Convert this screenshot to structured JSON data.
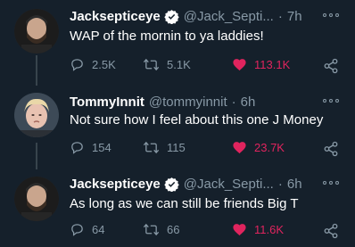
{
  "tweets": [
    {
      "name": "Jacksepticeye",
      "verified": true,
      "handle": "@Jack_Septi...",
      "separator": "·",
      "time": "7h",
      "text": "WAP of the mornin to ya laddies!",
      "replies": "2.5K",
      "retweets": "5.1K",
      "likes": "113.1K",
      "liked": true
    },
    {
      "name": "TommyInnit",
      "verified": false,
      "handle": "@tommyinnit",
      "separator": "·",
      "time": "6h",
      "text": "Not sure how I feel about this one J Money",
      "replies": "154",
      "retweets": "115",
      "likes": "23.7K",
      "liked": true
    },
    {
      "name": "Jacksepticeye",
      "verified": true,
      "handle": "@Jack_Septi...",
      "separator": "·",
      "time": "6h",
      "text": "As long as we can still be friends Big T",
      "replies": "64",
      "retweets": "66",
      "likes": "11.6K",
      "liked": true
    }
  ],
  "colors": {
    "background": "#15202b",
    "secondary_text": "#8899a6",
    "like_red": "#e0245e",
    "verified_blue": "#1da1f2"
  },
  "icons": [
    "reply-icon",
    "retweet-icon",
    "like-icon",
    "share-icon",
    "more-icon",
    "verified-icon"
  ]
}
